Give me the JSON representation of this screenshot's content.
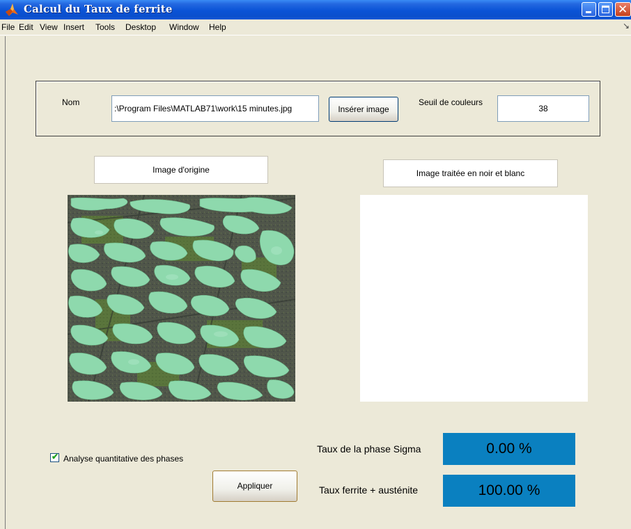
{
  "window": {
    "title": "Calcul du Taux de ferrite",
    "close_glyph": "✕"
  },
  "menubar": {
    "items": [
      "File",
      "Edit",
      "View",
      "Insert",
      "Tools",
      "Desktop",
      "Window",
      "Help"
    ],
    "overflow_glyph": "↘"
  },
  "form": {
    "nom_label": "Nom",
    "file_path": ":\\Program Files\\MATLAB71\\work\\15 minutes.jpg",
    "insert_button": "Insérer image",
    "seuil_label": "Seuil de couleurs",
    "seuil_value": "38"
  },
  "images": {
    "original_title": "Image d'origine",
    "processed_title": "Image traitée en noir et blanc"
  },
  "analysis": {
    "checkbox_label": "Analyse quantitative des phases",
    "checkbox_checked": true,
    "check_glyph": "✔",
    "apply_button": "Appliquer",
    "sigma_label": "Taux de la phase Sigma",
    "sigma_value": "0.00 %",
    "ferrite_label": "Taux ferrite + austénite",
    "ferrite_value": "100.00 %"
  },
  "colors": {
    "result_background": "#0a80c0",
    "titlebar": "#0a53d6",
    "micro_dark": "#51564a",
    "micro_light": "#8ed9ad"
  },
  "icons": {
    "app": "matlab-logo-icon",
    "minimize": "minimize-icon",
    "maximize": "maximize-icon",
    "close": "close-icon"
  }
}
